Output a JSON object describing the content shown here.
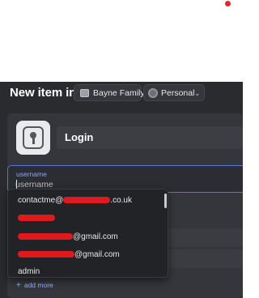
{
  "header": {
    "title": "New item in",
    "vault": "Bayne Family",
    "account": "Personal",
    "account_icon": "account-icon",
    "chevron_icon": "chevron-down-icon"
  },
  "item": {
    "type_label": "Login",
    "type_icon": "login-key-icon"
  },
  "username_field": {
    "label": "username",
    "placeholder": "username",
    "value": ""
  },
  "suggestions": [
    {
      "before": "contactme@",
      "after": ".co.uk",
      "redacted": true
    },
    {
      "before": "",
      "after": "",
      "redacted": true
    },
    {
      "before": "",
      "after": "@gmail.com",
      "redacted": true
    },
    {
      "before": "",
      "after": "@gmail.com",
      "redacted": true
    },
    {
      "before": "admin",
      "after": "",
      "redacted": false
    }
  ],
  "add_more": {
    "icon": "+",
    "label": "add more"
  },
  "colors": {
    "panel_bg": "#2a2b2f",
    "focus_border": "#5a76c8",
    "accent_text": "#8aa8f0",
    "redaction": "#e0191f",
    "recording_dot": "#e5242b"
  }
}
